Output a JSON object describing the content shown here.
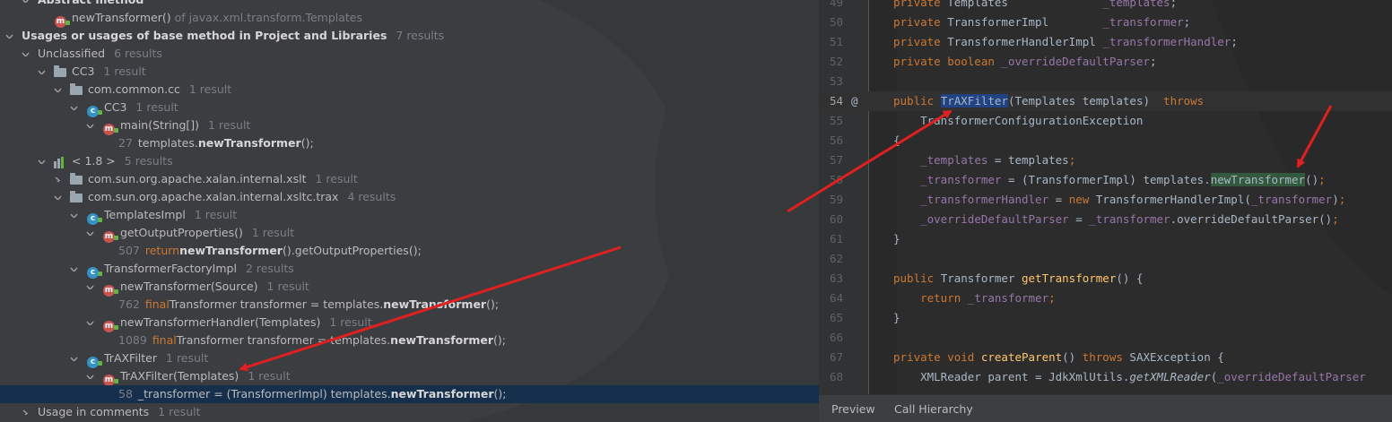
{
  "tree": [
    {
      "depth": 1,
      "expanded": true,
      "icon": "",
      "parts": [
        [
          "b",
          "Abstract method"
        ]
      ],
      "count": ""
    },
    {
      "depth": 2,
      "expanded": null,
      "icon": "method-icon",
      "parts": [
        [
          "t",
          "newTransformer()"
        ],
        [
          "of",
          "of javax.xml.transform.Templates"
        ]
      ],
      "count": ""
    },
    {
      "depth": 0,
      "expanded": true,
      "icon": "",
      "parts": [
        [
          "b",
          "Usages or usages of base method in Project and Libraries"
        ]
      ],
      "count": "7 results"
    },
    {
      "depth": 1,
      "expanded": true,
      "icon": "",
      "parts": [
        [
          "t",
          "Unclassified"
        ]
      ],
      "count": "6 results"
    },
    {
      "depth": 2,
      "expanded": true,
      "icon": "module-folder-icon",
      "parts": [
        [
          "t",
          "CC3"
        ]
      ],
      "count": "1 result"
    },
    {
      "depth": 3,
      "expanded": true,
      "icon": "package-icon",
      "parts": [
        [
          "t",
          "com.common.cc"
        ]
      ],
      "count": "1 result"
    },
    {
      "depth": 4,
      "expanded": true,
      "icon": "class-icon",
      "parts": [
        [
          "t",
          "CC3"
        ]
      ],
      "count": "1 result"
    },
    {
      "depth": 5,
      "expanded": true,
      "icon": "method-icon",
      "parts": [
        [
          "t",
          "main(String[])"
        ]
      ],
      "count": "1 result"
    },
    {
      "depth": 6,
      "expanded": null,
      "icon": "",
      "parts": [
        [
          "ln",
          "27"
        ],
        [
          "t",
          "templates."
        ],
        [
          "b",
          "newTransformer"
        ],
        [
          "t",
          "();"
        ]
      ],
      "count": ""
    },
    {
      "depth": 2,
      "expanded": true,
      "icon": "library-icon",
      "parts": [
        [
          "t",
          "< 1.8 >"
        ]
      ],
      "count": "5 results"
    },
    {
      "depth": 3,
      "expanded": false,
      "icon": "package-icon",
      "parts": [
        [
          "t",
          "com.sun.org.apache.xalan.internal.xslt"
        ]
      ],
      "count": "1 result"
    },
    {
      "depth": 3,
      "expanded": true,
      "icon": "package-icon",
      "parts": [
        [
          "t",
          "com.sun.org.apache.xalan.internal.xsltc.trax"
        ]
      ],
      "count": "4 results"
    },
    {
      "depth": 4,
      "expanded": true,
      "icon": "class-icon",
      "parts": [
        [
          "t",
          "TemplatesImpl"
        ]
      ],
      "count": "1 result"
    },
    {
      "depth": 5,
      "expanded": true,
      "icon": "method-icon",
      "parts": [
        [
          "t",
          "getOutputProperties()"
        ]
      ],
      "count": "1 result"
    },
    {
      "depth": 6,
      "expanded": null,
      "icon": "",
      "parts": [
        [
          "ln",
          "507"
        ],
        [
          "kw",
          "return "
        ],
        [
          "b",
          "newTransformer"
        ],
        [
          "t",
          "().getOutputProperties();"
        ]
      ],
      "count": ""
    },
    {
      "depth": 4,
      "expanded": true,
      "icon": "class-icon",
      "parts": [
        [
          "t",
          "TransformerFactoryImpl"
        ]
      ],
      "count": "2 results"
    },
    {
      "depth": 5,
      "expanded": true,
      "icon": "method-icon",
      "parts": [
        [
          "t",
          "newTransformer(Source)"
        ]
      ],
      "count": "1 result"
    },
    {
      "depth": 6,
      "expanded": null,
      "icon": "",
      "parts": [
        [
          "ln",
          "762"
        ],
        [
          "kw",
          "final "
        ],
        [
          "t",
          "Transformer transformer = templates."
        ],
        [
          "b",
          "newTransformer"
        ],
        [
          "t",
          "();"
        ]
      ],
      "count": ""
    },
    {
      "depth": 5,
      "expanded": true,
      "icon": "method-icon",
      "parts": [
        [
          "t",
          "newTransformerHandler(Templates)"
        ]
      ],
      "count": "1 result"
    },
    {
      "depth": 6,
      "expanded": null,
      "icon": "",
      "parts": [
        [
          "ln",
          "1089"
        ],
        [
          "kw",
          "final "
        ],
        [
          "t",
          "Transformer transformer = templates."
        ],
        [
          "b",
          "newTransformer"
        ],
        [
          "t",
          "();"
        ]
      ],
      "count": ""
    },
    {
      "depth": 4,
      "expanded": true,
      "icon": "class-icon",
      "parts": [
        [
          "t",
          "TrAXFilter"
        ]
      ],
      "count": "1 result"
    },
    {
      "depth": 5,
      "expanded": true,
      "icon": "method-icon",
      "parts": [
        [
          "t",
          "TrAXFilter(Templates)"
        ]
      ],
      "count": "1 result"
    },
    {
      "depth": 6,
      "expanded": null,
      "icon": "",
      "selected": true,
      "parts": [
        [
          "ln",
          "58"
        ],
        [
          "t",
          "_transformer = (TransformerImpl) templates."
        ],
        [
          "b",
          "newTransformer"
        ],
        [
          "t",
          "();"
        ]
      ],
      "count": ""
    },
    {
      "depth": 1,
      "expanded": false,
      "icon": "",
      "parts": [
        [
          "t",
          "Usage in comments"
        ]
      ],
      "count": "1 result"
    }
  ],
  "editor": {
    "lines": [
      {
        "n": "49",
        "tokens": [
          [
            "k",
            "private "
          ],
          [
            "t",
            "Templates              "
          ],
          [
            "f",
            "_templates"
          ],
          [
            "t",
            ";"
          ]
        ]
      },
      {
        "n": "50",
        "tokens": [
          [
            "k",
            "private "
          ],
          [
            "t",
            "TransformerImpl        "
          ],
          [
            "f",
            "_transformer"
          ],
          [
            "t",
            ";"
          ]
        ]
      },
      {
        "n": "51",
        "tokens": [
          [
            "k",
            "private "
          ],
          [
            "t",
            "TransformerHandlerImpl "
          ],
          [
            "f",
            "_transformerHandler"
          ],
          [
            "t",
            ";"
          ]
        ]
      },
      {
        "n": "52",
        "tokens": [
          [
            "k",
            "private boolean "
          ],
          [
            "f",
            "_overrideDefaultParser"
          ],
          [
            "t",
            ";"
          ]
        ]
      },
      {
        "n": "53",
        "tokens": []
      },
      {
        "n": "54",
        "current": true,
        "annotation": "@",
        "tokens": [
          [
            "k",
            "public "
          ],
          [
            "hb",
            "TrAXFilter"
          ],
          [
            "t",
            "(Templates templates)  "
          ],
          [
            "k",
            "throws"
          ]
        ]
      },
      {
        "n": "55",
        "tokens": [
          [
            "t",
            "    TransformerConfigurationException"
          ]
        ]
      },
      {
        "n": "56",
        "tokens": [
          [
            "t",
            "{"
          ]
        ]
      },
      {
        "n": "57",
        "tokens": [
          [
            "t",
            "    "
          ],
          [
            "f",
            "_templates"
          ],
          [
            "t",
            " = templates"
          ],
          [
            "k",
            ";"
          ]
        ]
      },
      {
        "n": "58",
        "tokens": [
          [
            "t",
            "    "
          ],
          [
            "f",
            "_transformer"
          ],
          [
            "t",
            " = (TransformerImpl) templates."
          ],
          [
            "hg",
            "newTransformer"
          ],
          [
            "t",
            "()"
          ],
          [
            "k",
            ";"
          ]
        ]
      },
      {
        "n": "59",
        "tokens": [
          [
            "t",
            "    "
          ],
          [
            "f",
            "_transformerHandler"
          ],
          [
            "t",
            " = "
          ],
          [
            "k",
            "new "
          ],
          [
            "t",
            "TransformerHandlerImpl("
          ],
          [
            "f",
            "_transformer"
          ],
          [
            "t",
            ")"
          ],
          [
            "k",
            ";"
          ]
        ]
      },
      {
        "n": "60",
        "tokens": [
          [
            "t",
            "    "
          ],
          [
            "f",
            "_overrideDefaultParser"
          ],
          [
            "t",
            " = "
          ],
          [
            "f",
            "_transformer"
          ],
          [
            "t",
            ".overrideDefaultParser()"
          ],
          [
            "k",
            ";"
          ]
        ]
      },
      {
        "n": "61",
        "tokens": [
          [
            "t",
            "}"
          ]
        ]
      },
      {
        "n": "62",
        "tokens": []
      },
      {
        "n": "63",
        "tokens": [
          [
            "k",
            "public "
          ],
          [
            "t",
            "Transformer "
          ],
          [
            "fn",
            "getTransformer"
          ],
          [
            "t",
            "() {"
          ]
        ]
      },
      {
        "n": "64",
        "tokens": [
          [
            "t",
            "    "
          ],
          [
            "k",
            "return "
          ],
          [
            "f",
            "_transformer"
          ],
          [
            "k",
            ";"
          ]
        ]
      },
      {
        "n": "65",
        "tokens": [
          [
            "t",
            "}"
          ]
        ]
      },
      {
        "n": "66",
        "tokens": []
      },
      {
        "n": "67",
        "tokens": [
          [
            "k",
            "private void "
          ],
          [
            "fn",
            "createParent"
          ],
          [
            "t",
            "() "
          ],
          [
            "k",
            "throws "
          ],
          [
            "t",
            "SAXException {"
          ]
        ]
      },
      {
        "n": "68",
        "tokens": [
          [
            "t",
            "    XMLReader parent = JdkXmlUtils."
          ],
          [
            "i",
            "getXMLReader"
          ],
          [
            "t",
            "("
          ],
          [
            "f",
            "_overrideDefaultParser"
          ]
        ]
      }
    ]
  },
  "bottom_tabs": [
    "Preview",
    "Call Hierarchy"
  ],
  "colors": {
    "accent": "#e02020",
    "selection": "#0d293e",
    "keyword": "#cc7832",
    "field": "#9876aa"
  }
}
